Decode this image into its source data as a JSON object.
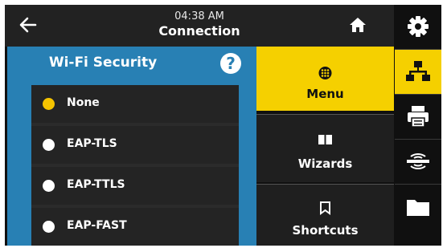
{
  "header": {
    "time": "04:38 AM",
    "title": "Connection"
  },
  "security": {
    "title": "Wi-Fi Security",
    "help_label": "?",
    "options": [
      {
        "label": "None",
        "selected": true
      },
      {
        "label": "EAP-TLS",
        "selected": false
      },
      {
        "label": "EAP-TTLS",
        "selected": false
      },
      {
        "label": "EAP-FAST",
        "selected": false
      }
    ]
  },
  "nav": {
    "menu": "Menu",
    "wizards": "Wizards",
    "shortcuts": "Shortcuts"
  },
  "sidebar": {
    "items": [
      "gear-icon",
      "network-icon",
      "printer-icon",
      "wireless-sensor-icon",
      "folder-icon"
    ],
    "active": "network-icon"
  },
  "colors": {
    "accent": "#f5d000",
    "panel": "#2880b4",
    "header": "#222222"
  }
}
